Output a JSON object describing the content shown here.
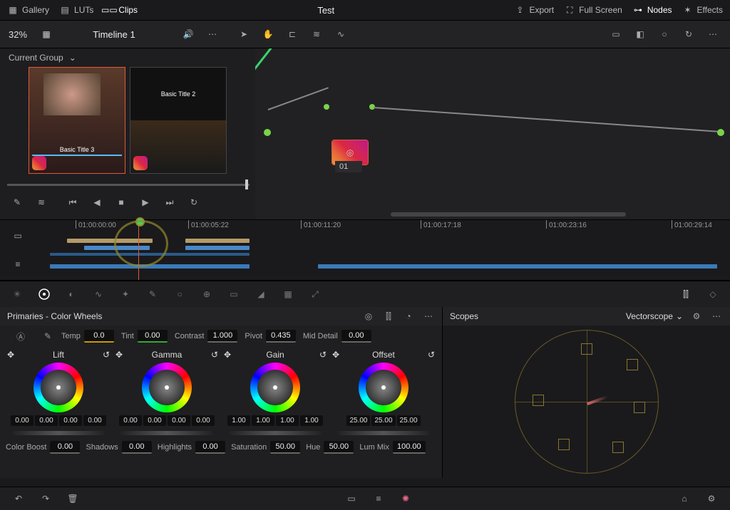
{
  "topbar": {
    "left": [
      {
        "name": "gallery",
        "label": "Gallery"
      },
      {
        "name": "luts",
        "label": "LUTs"
      },
      {
        "name": "clips",
        "label": "Clips",
        "active": true
      }
    ],
    "title": "Test",
    "right": [
      {
        "name": "export",
        "label": "Export"
      },
      {
        "name": "fullscreen",
        "label": "Full Screen"
      },
      {
        "name": "nodes",
        "label": "Nodes",
        "active": true
      },
      {
        "name": "effects",
        "label": "Effects"
      }
    ]
  },
  "secbar": {
    "zoom": "32%",
    "timeline": "Timeline 1"
  },
  "group_label": "Current Group",
  "thumbs": [
    {
      "title": "Basic Title 3",
      "hasBadge": true
    },
    {
      "title": "Basic Title 2",
      "hasBadge": true
    }
  ],
  "node": {
    "label": "01"
  },
  "timeline": {
    "ticks": [
      "01:00:00:00",
      "01:00:05:22",
      "01:00:11:20",
      "01:00:17:18",
      "01:00:23:16",
      "01:00:29:14"
    ]
  },
  "primaries": {
    "title": "Primaries - Color Wheels",
    "top": {
      "temp_l": "Temp",
      "temp": "0.0",
      "tint_l": "Tint",
      "tint": "0.00",
      "contrast_l": "Contrast",
      "contrast": "1.000",
      "pivot_l": "Pivot",
      "pivot": "0.435",
      "mid_l": "Mid Detail",
      "mid": "0.00"
    },
    "wheels": [
      {
        "name": "Lift",
        "vals": [
          "0.00",
          "0.00",
          "0.00",
          "0.00"
        ]
      },
      {
        "name": "Gamma",
        "vals": [
          "0.00",
          "0.00",
          "0.00",
          "0.00"
        ]
      },
      {
        "name": "Gain",
        "vals": [
          "1.00",
          "1.00",
          "1.00",
          "1.00"
        ]
      },
      {
        "name": "Offset",
        "vals": [
          "25.00",
          "25.00",
          "25.00"
        ]
      }
    ],
    "bottom": {
      "cb_l": "Color Boost",
      "cb": "0.00",
      "sh_l": "Shadows",
      "sh": "0.00",
      "hl_l": "Highlights",
      "hl": "0.00",
      "sat_l": "Saturation",
      "sat": "50.00",
      "hue_l": "Hue",
      "hue": "50.00",
      "lm_l": "Lum Mix",
      "lm": "100.00"
    }
  },
  "scopes": {
    "title": "Scopes",
    "mode": "Vectorscope"
  }
}
